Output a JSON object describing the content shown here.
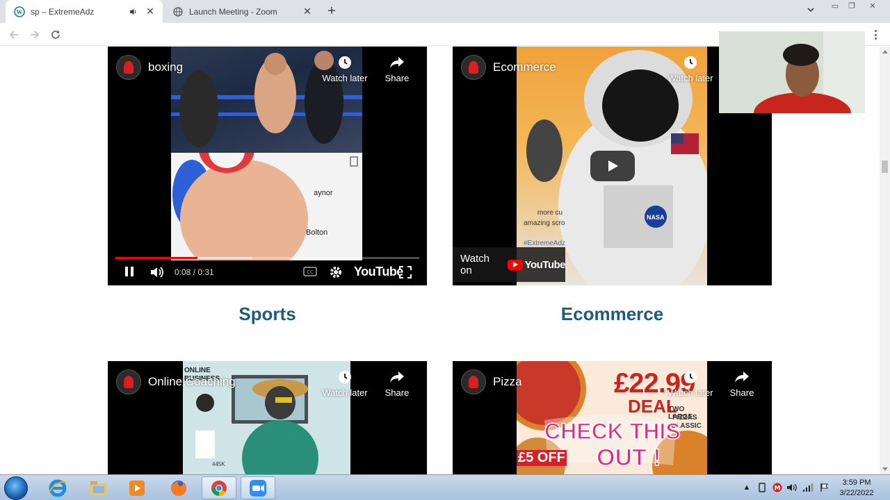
{
  "browser": {
    "tabs": [
      {
        "title": "sp – ExtremeAdz",
        "active": true,
        "icon": "wordpress-icon",
        "audio": true
      },
      {
        "title": "Launch Meeting - Zoom",
        "active": false,
        "icon": "zoom-globe-icon",
        "audio": false
      }
    ]
  },
  "videos": [
    {
      "title": "boxing",
      "watch_later": "Watch later",
      "share": "Share",
      "time": "0:08 / 0:31",
      "progress": 0.27,
      "buffered": 0.45,
      "youtube": "YouTube",
      "caption": "Sports",
      "overlay_labels": [
        "aynor",
        "Bolton"
      ]
    },
    {
      "title": "Ecommerce",
      "watch_later": "Watch later",
      "watch_on": "Watch on",
      "youtube": "YouTube",
      "caption": "Ecommerce",
      "overlay_labels": [
        "more cu",
        "amazing scro",
        "#ExtremeAdz",
        "NASA"
      ]
    },
    {
      "title": "Online Coaching",
      "watch_later": "Watch later",
      "share": "Share",
      "overlay_labels": [
        "ONLINE",
        "BUSINESS",
        "445K"
      ]
    },
    {
      "title": "Pizza",
      "watch_later": "Watch later",
      "share": "Share",
      "overlay_labels": [
        "£22.99",
        "DEAL",
        "TWO LARGE",
        "PIZZAS",
        "CLASSIC",
        "CHECK THIS",
        "OUT !",
        "£5 OFF"
      ]
    }
  ],
  "taskbar": {
    "apps": [
      "internet-explorer-icon",
      "file-explorer-icon",
      "media-player-icon",
      "firefox-icon",
      "chrome-icon",
      "zoom-icon"
    ],
    "active_app": "chrome-icon",
    "time": "3:59 PM",
    "date": "3/22/2022"
  },
  "colors": {
    "caption": "#1f5c7a",
    "youtube_red": "#ff0000",
    "tabbar": "#dee1e6"
  }
}
